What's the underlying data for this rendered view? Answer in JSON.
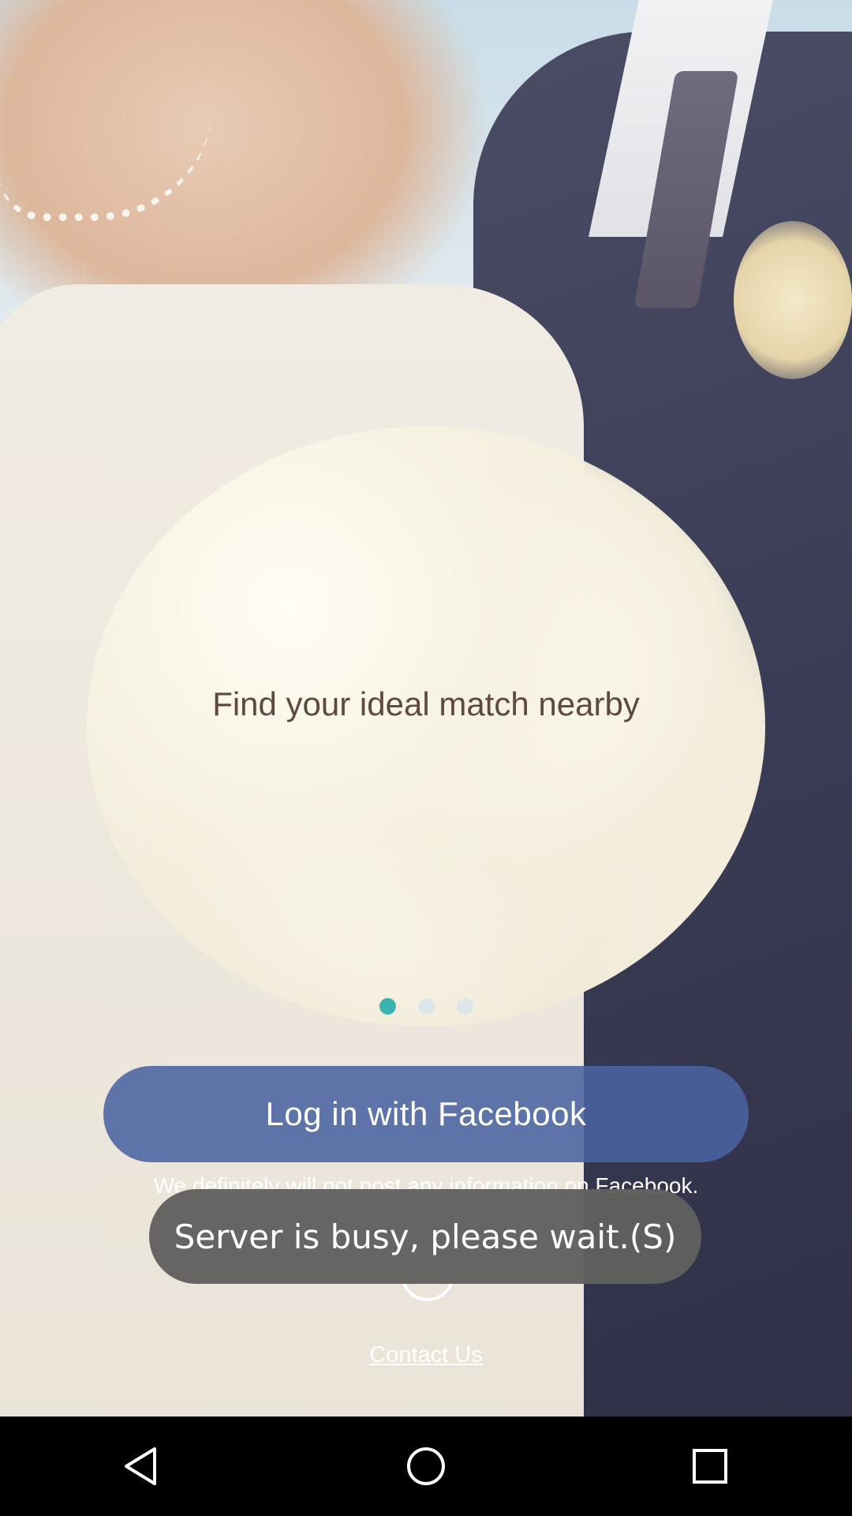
{
  "tagline": "Find your ideal match nearby",
  "pager": {
    "count": 3,
    "active_index": 0,
    "active_color": "#3bb3b0",
    "inactive_color": "#dfe6ea"
  },
  "facebook_button": {
    "label": "Log in with Facebook",
    "color": "#4a63a0"
  },
  "disclaimer": "We definitely will not post any information on Facebook.",
  "help_icon": "question-mark-icon",
  "toast": {
    "message": "Server is busy, please wait.(S)"
  },
  "contact_link": "Contact Us",
  "system_nav": {
    "back_icon": "back-triangle-icon",
    "home_icon": "home-circle-icon",
    "recents_icon": "recents-square-icon"
  }
}
